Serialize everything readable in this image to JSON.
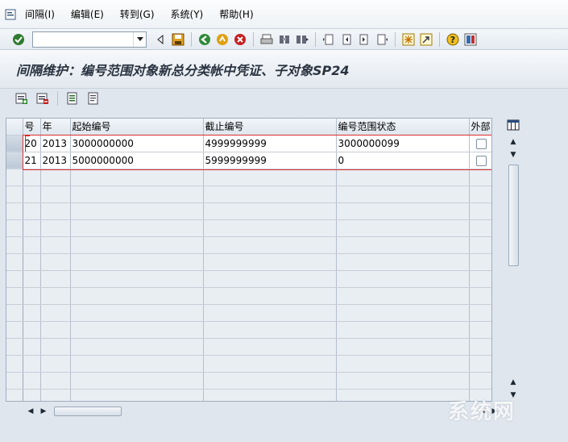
{
  "menu": {
    "items": [
      "间隔(I)",
      "编辑(E)",
      "转到(G)",
      "系统(Y)",
      "帮助(H)"
    ]
  },
  "toolbar": {
    "command_value": "",
    "icons": [
      "check-icon",
      "back-icon",
      "exit-icon",
      "cancel-icon",
      "save-icon",
      "print-icon",
      "find-icon",
      "find-next-icon",
      "first-page-icon",
      "prev-page-icon",
      "next-page-icon",
      "last-page-icon",
      "new-session-icon",
      "shortcut-icon",
      "help-icon",
      "layout-icon"
    ]
  },
  "title": "间隔维护：编号范围对象新总分类帐中凭证、子对象SP24",
  "app_toolbar": {
    "icons": [
      "insert-interval-icon",
      "delete-interval-icon",
      "details-icon",
      "overview-icon"
    ]
  },
  "table": {
    "columns": [
      "号",
      "年",
      "起始编号",
      "截止编号",
      "编号范围状态",
      "外部"
    ],
    "rows": [
      {
        "no": "20",
        "year": "2013",
        "from": "3000000000",
        "to": "4999999999",
        "status": "3000000099",
        "external": false
      },
      {
        "no": "21",
        "year": "2013",
        "from": "5000000000",
        "to": "5999999999",
        "status": "0",
        "external": false
      }
    ]
  },
  "watermark": "系统网",
  "colors": {
    "highlight": "#e03030",
    "background": "#dfe6ee"
  }
}
